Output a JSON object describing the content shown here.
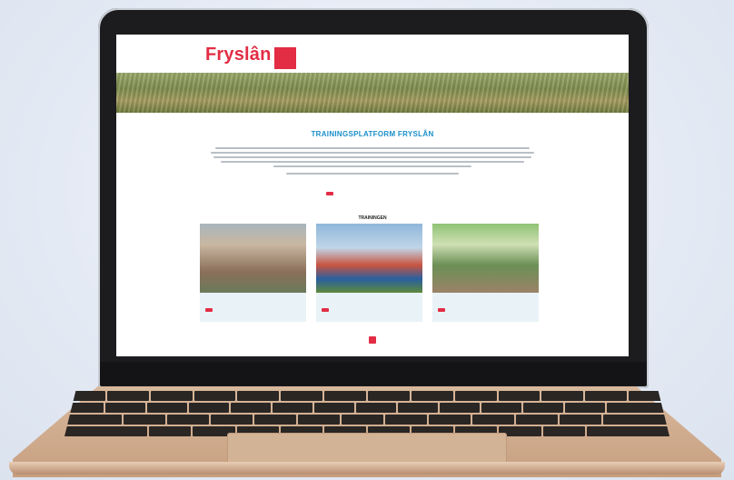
{
  "site": {
    "logo": "Fryslân",
    "nav": {
      "items": [
        "",
        "",
        ""
      ],
      "login": ""
    }
  },
  "main": {
    "title": "TRAININGSPLATFORM FRYSLÂN",
    "section_title": "TRAININGEN",
    "cards": [
      {
        "label": "",
        "type": "",
        "button": ""
      },
      {
        "label": "",
        "type": "",
        "button": ""
      },
      {
        "label": "",
        "type": "",
        "button": ""
      }
    ],
    "signup_question": "",
    "signup_button": "",
    "more_button": ""
  },
  "colors": {
    "brand_red": "#e22d44",
    "title_blue": "#1a8fc9"
  }
}
